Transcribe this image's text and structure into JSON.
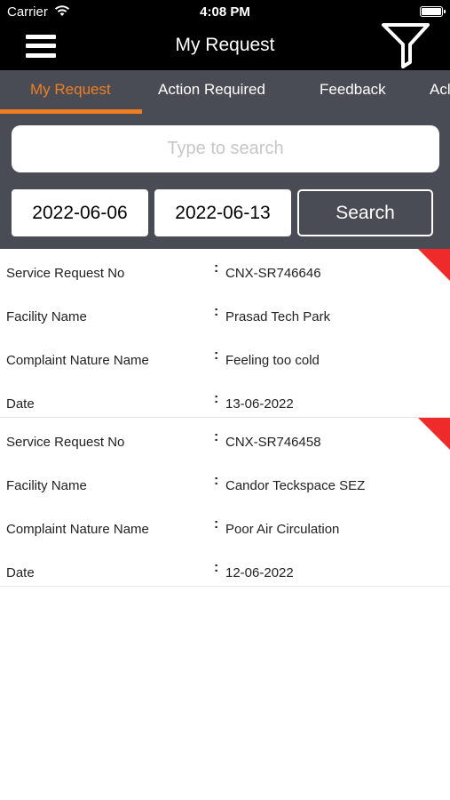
{
  "status_bar": {
    "carrier": "Carrier",
    "time": "4:08 PM"
  },
  "nav": {
    "title": "My Request"
  },
  "tabs": [
    {
      "label": "My Request",
      "active": true
    },
    {
      "label": "Action Required",
      "active": false
    },
    {
      "label": "Feedback",
      "active": false
    },
    {
      "label": "Acl",
      "active": false
    }
  ],
  "filters": {
    "search_placeholder": "Type to search",
    "from_date": "2022-06-06",
    "to_date": "2022-06-13",
    "search_label": "Search"
  },
  "labels": {
    "service_request_no": "Service Request No",
    "facility_name": "Facility Name",
    "complaint_nature_name": "Complaint Nature Name",
    "date": "Date",
    "colon": ":"
  },
  "requests": [
    {
      "service_request_no": "CNX-SR746646",
      "facility_name": "Prasad Tech Park",
      "complaint_nature_name": "Feeling too cold",
      "date": "13-06-2022"
    },
    {
      "service_request_no": "CNX-SR746458",
      "facility_name": "Candor Teckspace SEZ",
      "complaint_nature_name": "Poor Air Circulation",
      "date": "12-06-2022"
    }
  ],
  "colors": {
    "accent": "#ef7e23",
    "toolbar": "#4a4c55",
    "flag": "#ef2a2a"
  }
}
